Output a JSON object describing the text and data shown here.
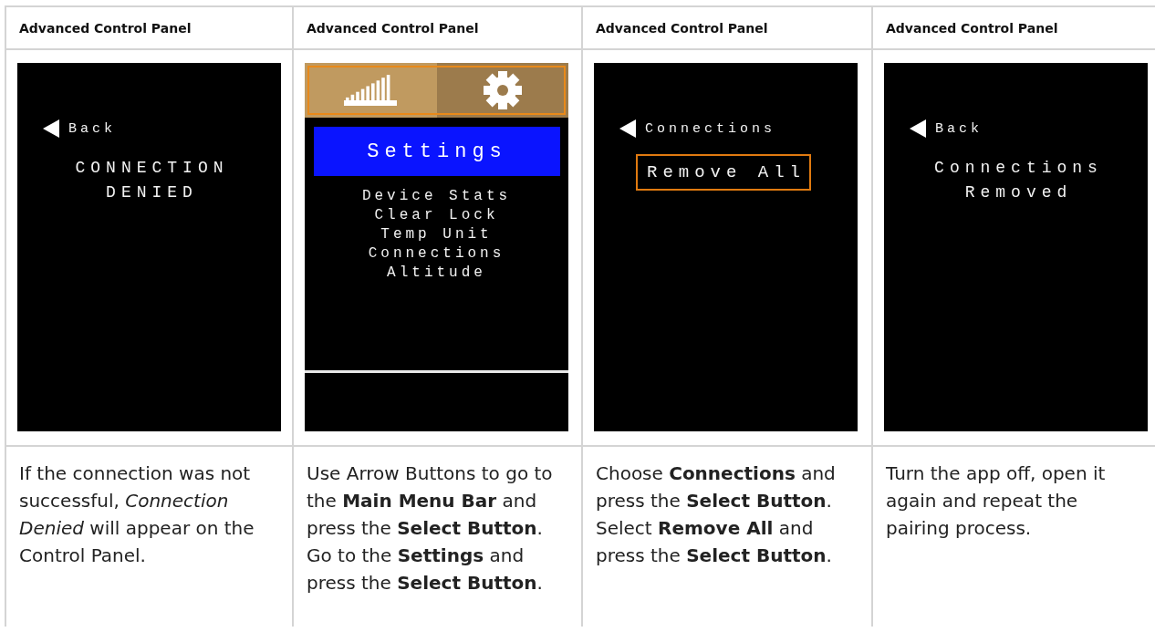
{
  "columns": [
    {
      "header": "Advanced Control Panel",
      "screen": {
        "kind": "message",
        "back": "Back",
        "lines": [
          "CONNECTION",
          "DENIED"
        ]
      },
      "description": "If the connection was not successful, *Connection Denied* will appear on the Control Panel."
    },
    {
      "header": "Advanced Control Panel",
      "screen": {
        "kind": "menu",
        "tabs": [
          {
            "selected": false
          },
          {
            "selected": true
          }
        ],
        "title": "Settings",
        "items": [
          "Device Stats",
          "Clear Lock",
          "Temp Unit",
          "Connections",
          "Altitude"
        ]
      },
      "description": "Use Arrow Buttons to go to the **Main Menu Bar** and press the **Select Button**. Go to the **Settings** and press the **Select Button**."
    },
    {
      "header": "Advanced Control Panel",
      "screen": {
        "kind": "options",
        "back": "Connections",
        "options": [
          {
            "label": "Remove All",
            "selected": true
          }
        ]
      },
      "description": "Choose **Connections** and press the **Select Button**. Select **Remove All** and press the **Select Button**."
    },
    {
      "header": "Advanced Control Panel",
      "screen": {
        "kind": "message",
        "back": "Back",
        "lines": [
          "Connections",
          "Removed"
        ]
      },
      "description": "Turn the app off, open it again and repeat the pairing process."
    }
  ]
}
